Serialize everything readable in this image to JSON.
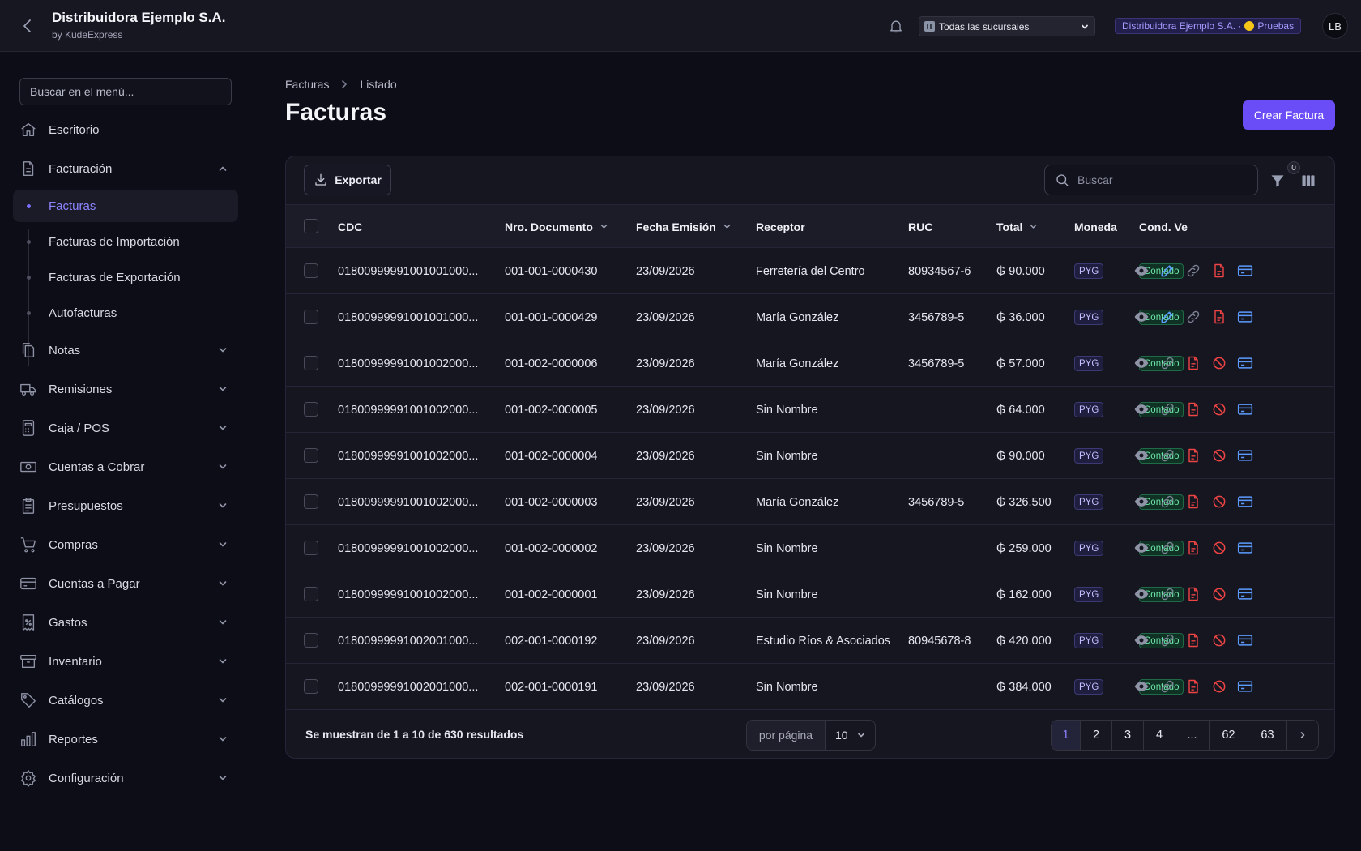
{
  "topbar": {
    "company": "Distribuidora Ejemplo S.A.",
    "by": "by KudeExpress",
    "branch_select": "Todas las sucursales",
    "env_company": "Distribuidora Ejemplo S.A. ·",
    "env_label": "Pruebas",
    "user_initials": "LB"
  },
  "sidebar": {
    "search_placeholder": "Buscar en el menú...",
    "items": [
      {
        "label": "Escritorio",
        "icon": "home-icon"
      },
      {
        "label": "Facturación",
        "icon": "document-icon",
        "expanded": true
      },
      {
        "label": "Notas",
        "icon": "documents-icon"
      },
      {
        "label": "Remisiones",
        "icon": "truck-icon"
      },
      {
        "label": "Caja / POS",
        "icon": "calculator-icon"
      },
      {
        "label": "Cuentas a Cobrar",
        "icon": "cash-icon"
      },
      {
        "label": "Presupuestos",
        "icon": "clipboard-icon"
      },
      {
        "label": "Compras",
        "icon": "cart-icon"
      },
      {
        "label": "Cuentas a Pagar",
        "icon": "credit-card-icon"
      },
      {
        "label": "Gastos",
        "icon": "receipt-percent-icon"
      },
      {
        "label": "Inventario",
        "icon": "archive-box-icon"
      },
      {
        "label": "Catálogos",
        "icon": "tag-icon"
      },
      {
        "label": "Reportes",
        "icon": "bar-chart-icon"
      },
      {
        "label": "Configuración",
        "icon": "gear-icon"
      }
    ],
    "sub_items": [
      {
        "label": "Facturas",
        "active": true
      },
      {
        "label": "Facturas de Importación",
        "active": false
      },
      {
        "label": "Facturas de Exportación",
        "active": false
      },
      {
        "label": "Autofacturas",
        "active": false
      }
    ]
  },
  "main": {
    "breadcrumb": [
      "Facturas",
      "Listado"
    ],
    "title": "Facturas",
    "create_button": "Crear Factura"
  },
  "table": {
    "export_label": "Exportar",
    "search_placeholder": "Buscar",
    "filter_count": "0",
    "headers": {
      "cdc": "CDC",
      "nro": "Nro. Documento",
      "fecha": "Fecha Emisión",
      "receptor": "Receptor",
      "ruc": "RUC",
      "total": "Total",
      "moneda": "Moneda",
      "cond": "Cond. Ve"
    },
    "rows": [
      {
        "cdc": "01800999991001001000...",
        "nro": "001-001-0000430",
        "fecha": "23/09/2026",
        "receptor": "Ferretería del Centro",
        "ruc": "80934567-6",
        "total": "₲ 90.000",
        "moneda": "PYG",
        "cond": "Contado",
        "actions": [
          "view",
          "edit",
          "link",
          "pdf",
          "payment"
        ]
      },
      {
        "cdc": "01800999991001001000...",
        "nro": "001-001-0000429",
        "fecha": "23/09/2026",
        "receptor": "María González",
        "ruc": "3456789-5",
        "total": "₲ 36.000",
        "moneda": "PYG",
        "cond": "Contado",
        "actions": [
          "view",
          "edit",
          "link",
          "pdf",
          "payment"
        ]
      },
      {
        "cdc": "01800999991001002000...",
        "nro": "001-002-0000006",
        "fecha": "23/09/2026",
        "receptor": "María González",
        "ruc": "3456789-5",
        "total": "₲ 57.000",
        "moneda": "PYG",
        "cond": "Contado",
        "actions": [
          "view",
          "link",
          "pdf",
          "cancel",
          "payment"
        ]
      },
      {
        "cdc": "01800999991001002000...",
        "nro": "001-002-0000005",
        "fecha": "23/09/2026",
        "receptor": "Sin Nombre",
        "ruc": "",
        "total": "₲ 64.000",
        "moneda": "PYG",
        "cond": "Contado",
        "actions": [
          "view",
          "link",
          "pdf",
          "cancel",
          "payment"
        ]
      },
      {
        "cdc": "01800999991001002000...",
        "nro": "001-002-0000004",
        "fecha": "23/09/2026",
        "receptor": "Sin Nombre",
        "ruc": "",
        "total": "₲ 90.000",
        "moneda": "PYG",
        "cond": "Contado",
        "actions": [
          "view",
          "link",
          "pdf",
          "cancel",
          "payment"
        ]
      },
      {
        "cdc": "01800999991001002000...",
        "nro": "001-002-0000003",
        "fecha": "23/09/2026",
        "receptor": "María González",
        "ruc": "3456789-5",
        "total": "₲ 326.500",
        "moneda": "PYG",
        "cond": "Contado",
        "actions": [
          "view",
          "link",
          "pdf",
          "cancel",
          "payment"
        ]
      },
      {
        "cdc": "01800999991001002000...",
        "nro": "001-002-0000002",
        "fecha": "23/09/2026",
        "receptor": "Sin Nombre",
        "ruc": "",
        "total": "₲ 259.000",
        "moneda": "PYG",
        "cond": "Contado",
        "actions": [
          "view",
          "link",
          "pdf",
          "cancel",
          "payment"
        ]
      },
      {
        "cdc": "01800999991001002000...",
        "nro": "001-002-0000001",
        "fecha": "23/09/2026",
        "receptor": "Sin Nombre",
        "ruc": "",
        "total": "₲ 162.000",
        "moneda": "PYG",
        "cond": "Contado",
        "actions": [
          "view",
          "link",
          "pdf",
          "cancel",
          "payment"
        ]
      },
      {
        "cdc": "01800999991002001000...",
        "nro": "002-001-0000192",
        "fecha": "23/09/2026",
        "receptor": "Estudio Ríos & Asociados",
        "ruc": "80945678-8",
        "total": "₲ 420.000",
        "moneda": "PYG",
        "cond": "Contado",
        "actions": [
          "view",
          "link",
          "pdf",
          "cancel",
          "payment"
        ]
      },
      {
        "cdc": "01800999991002001000...",
        "nro": "002-001-0000191",
        "fecha": "23/09/2026",
        "receptor": "Sin Nombre",
        "ruc": "",
        "total": "₲ 384.000",
        "moneda": "PYG",
        "cond": "Contado",
        "actions": [
          "view",
          "link",
          "pdf",
          "cancel",
          "payment"
        ]
      }
    ],
    "summary": "Se muestran de 1 a 10 de 630 resultados",
    "per_page_label": "por página",
    "per_page_value": "10",
    "pages": [
      "1",
      "2",
      "3",
      "4",
      "...",
      "62",
      "63"
    ],
    "current_page": "1"
  },
  "colors": {
    "accent": "#6b4df7",
    "accent_text": "#8b84ff",
    "success_text": "#6ee7a8",
    "danger": "#ef4444",
    "info": "#5b9bff"
  }
}
